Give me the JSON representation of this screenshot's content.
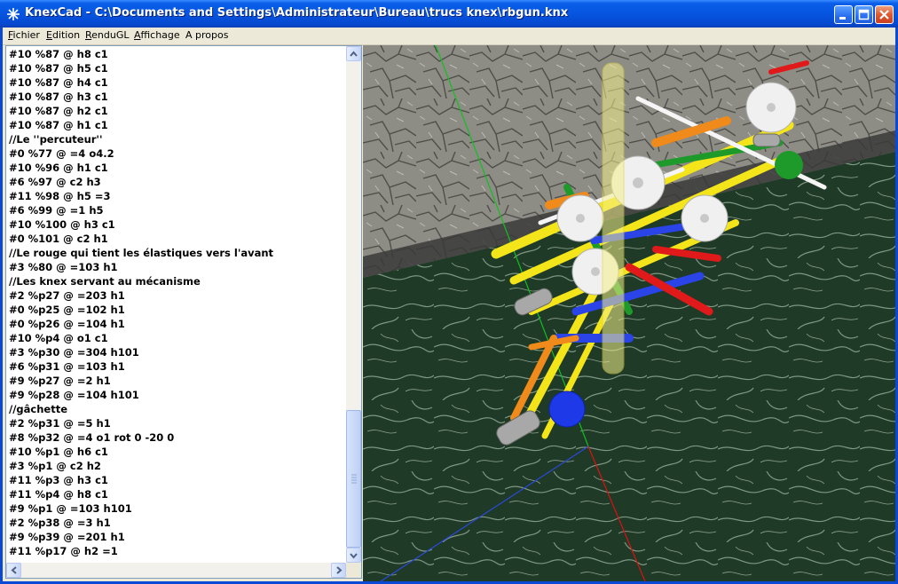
{
  "window": {
    "title": "KnexCad - C:\\Documents and Settings\\Administrateur\\Bureau\\trucs knex\\rbgun.knx",
    "icon": "knexcad-app-icon"
  },
  "controls": {
    "minimize_icon": "minimize-icon",
    "maximize_icon": "maximize-icon",
    "close_icon": "close-icon"
  },
  "menu": [
    {
      "label": "Fichier",
      "key": "F"
    },
    {
      "label": "Edition",
      "key": "E"
    },
    {
      "label": "RenduGL",
      "key": "R"
    },
    {
      "label": "Affichage",
      "key": "A"
    },
    {
      "label": "A propos",
      "key": ""
    }
  ],
  "editor": {
    "lines": [
      "#10 %87 @ h8 c1",
      "#10 %87 @ h5 c1",
      "#10 %87 @ h4 c1",
      "#10 %87 @ h3 c1",
      "#10 %87 @ h2 c1",
      "#10 %87 @ h1 c1",
      "//Le ''percuteur''",
      "#0 %77 @ =4 o4.2",
      "#10 %96 @ h1 c1",
      "#6 %97 @ c2 h3",
      "#11 %98 @ h5 =3",
      "#6 %99 @ =1 h5",
      "#10 %100 @ h3 c1",
      "#0 %101 @ c2 h1",
      "//Le rouge qui tient les élastiques vers l'avant",
      "#3 %80 @ =103 h1",
      "//Les knex servant au mécanisme",
      "#2 %p27 @ =203 h1",
      "#0 %p25 @ =102 h1",
      "#0 %p26 @ =104 h1",
      "#10 %p4 @ o1 c1",
      "#3 %p30 @ =304 h101",
      "#6 %p31 @ =103 h1",
      "#9 %p27 @ =2 h1",
      "#9 %p28 @ =104 h101",
      "//gâchette",
      "#2 %p31 @ =5 h1",
      "#8 %p32 @ =4 o1 rot 0 -20 0",
      "#10 %p1 @ h6 c1",
      "#3 %p1 @ c2 h2",
      "#11 %p3 @ h3 c1",
      "#11 %p4 @ h8 c1",
      "#9 %p1 @ =103 h101",
      "#2 %p38 @ =3 h1",
      "#9 %p39 @ =201 h1",
      "#11 %p17 @ h2 =1"
    ]
  },
  "colors": {
    "titlebar": "#0655e0",
    "menubar": "#ece9d8",
    "floor": "#1f3a26",
    "wall": "#8a8a82",
    "axis_x": "#e01010",
    "axis_y": "#10c020",
    "axis_z": "#2a4ae0"
  }
}
